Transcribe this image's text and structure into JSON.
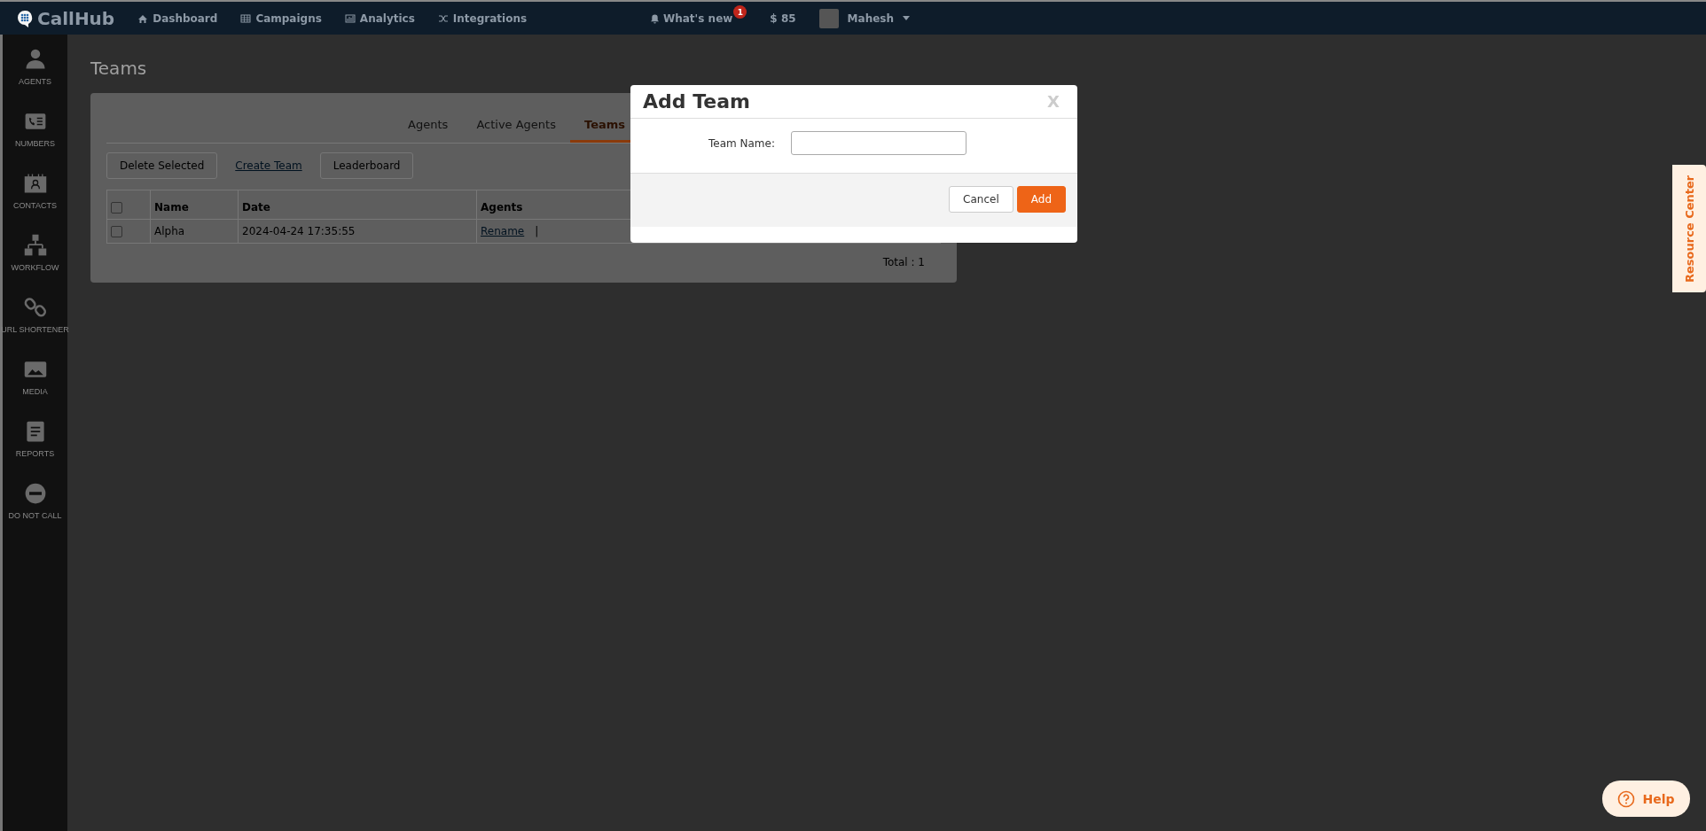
{
  "topbar": {
    "logo": "CallHub",
    "nav": [
      {
        "label": "Dashboard"
      },
      {
        "label": "Campaigns"
      },
      {
        "label": "Analytics"
      },
      {
        "label": "Integrations"
      }
    ],
    "whats_new": {
      "label": "What's new",
      "badge": "1"
    },
    "balance": "$ 85",
    "user": "Mahesh"
  },
  "sidebar": {
    "items": [
      {
        "label": "AGENTS"
      },
      {
        "label": "NUMBERS"
      },
      {
        "label": "CONTACTS"
      },
      {
        "label": "WORKFLOW"
      },
      {
        "label": "URL SHORTENER"
      },
      {
        "label": "MEDIA"
      },
      {
        "label": "REPORTS"
      },
      {
        "label": "DO NOT CALL"
      }
    ]
  },
  "page": {
    "title": "Teams",
    "tabs": [
      {
        "label": "Agents",
        "selected": false
      },
      {
        "label": "Active Agents",
        "selected": false
      },
      {
        "label": "Teams",
        "selected": true
      }
    ],
    "actions": [
      {
        "label": "Delete Selected",
        "kind": "button"
      },
      {
        "label": "Create Team",
        "kind": "link"
      },
      {
        "label": "Leaderboard",
        "kind": "button"
      }
    ],
    "table": {
      "header_checked": false,
      "columns": [
        "Name",
        "Date",
        "Agents"
      ],
      "rows": [
        {
          "checked": false,
          "name": "Alpha",
          "date": "2024-04-24 17:35:55",
          "link": "Rename",
          "separator": "|"
        }
      ]
    },
    "total": "Total : 1"
  },
  "dialog": {
    "title": "Add Team",
    "close": "X",
    "field_label": "Team Name:",
    "buttons": [
      {
        "label": "Cancel",
        "kind": "secondary"
      },
      {
        "label": "Add",
        "kind": "primary"
      }
    ]
  },
  "resource_center": "Resource Center",
  "help": "Help"
}
